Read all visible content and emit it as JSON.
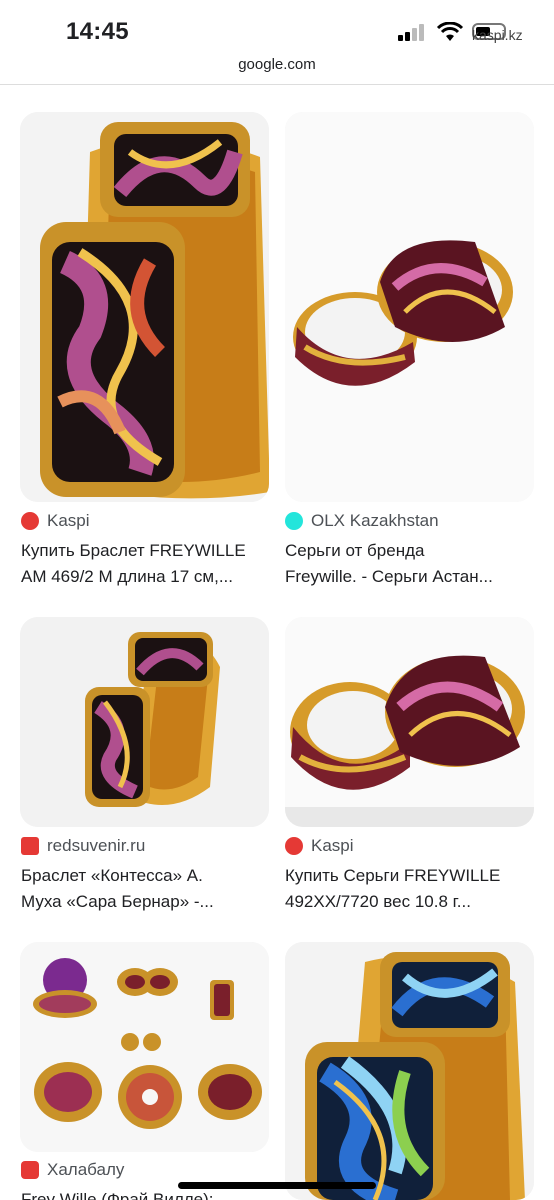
{
  "status_bar": {
    "time": "14:45",
    "carrier": "kaspi.kz"
  },
  "browser": {
    "url": "google.com"
  },
  "results": [
    {
      "source": "Kaspi",
      "title_line1": "Купить Браслет FREYWILLE",
      "title_line2": "AM 469/2 M длина 17 см,...",
      "favicon_color": "#e53935"
    },
    {
      "source": "OLX Kazakhstan",
      "title_line1": "Серьги от бренда",
      "title_line2": "Freywille. - Серьги Астан...",
      "favicon_color": "#23e5db"
    },
    {
      "source": "redsuvenir.ru",
      "title_line1": "Браслет «Контесса» А.",
      "title_line2": "Муха «Сара Бернар» -...",
      "favicon_color": "#e53935"
    },
    {
      "source": "Kaspi",
      "title_line1": "Купить Серьги FREYWILLE",
      "title_line2": "492XX/7720 вес 10.8 г...",
      "favicon_color": "#e53935"
    },
    {
      "source": "Халабалу",
      "title_line1": "Frey Wille (Фрай Вилле):",
      "title_line2": "",
      "favicon_color": "#e53935"
    }
  ]
}
